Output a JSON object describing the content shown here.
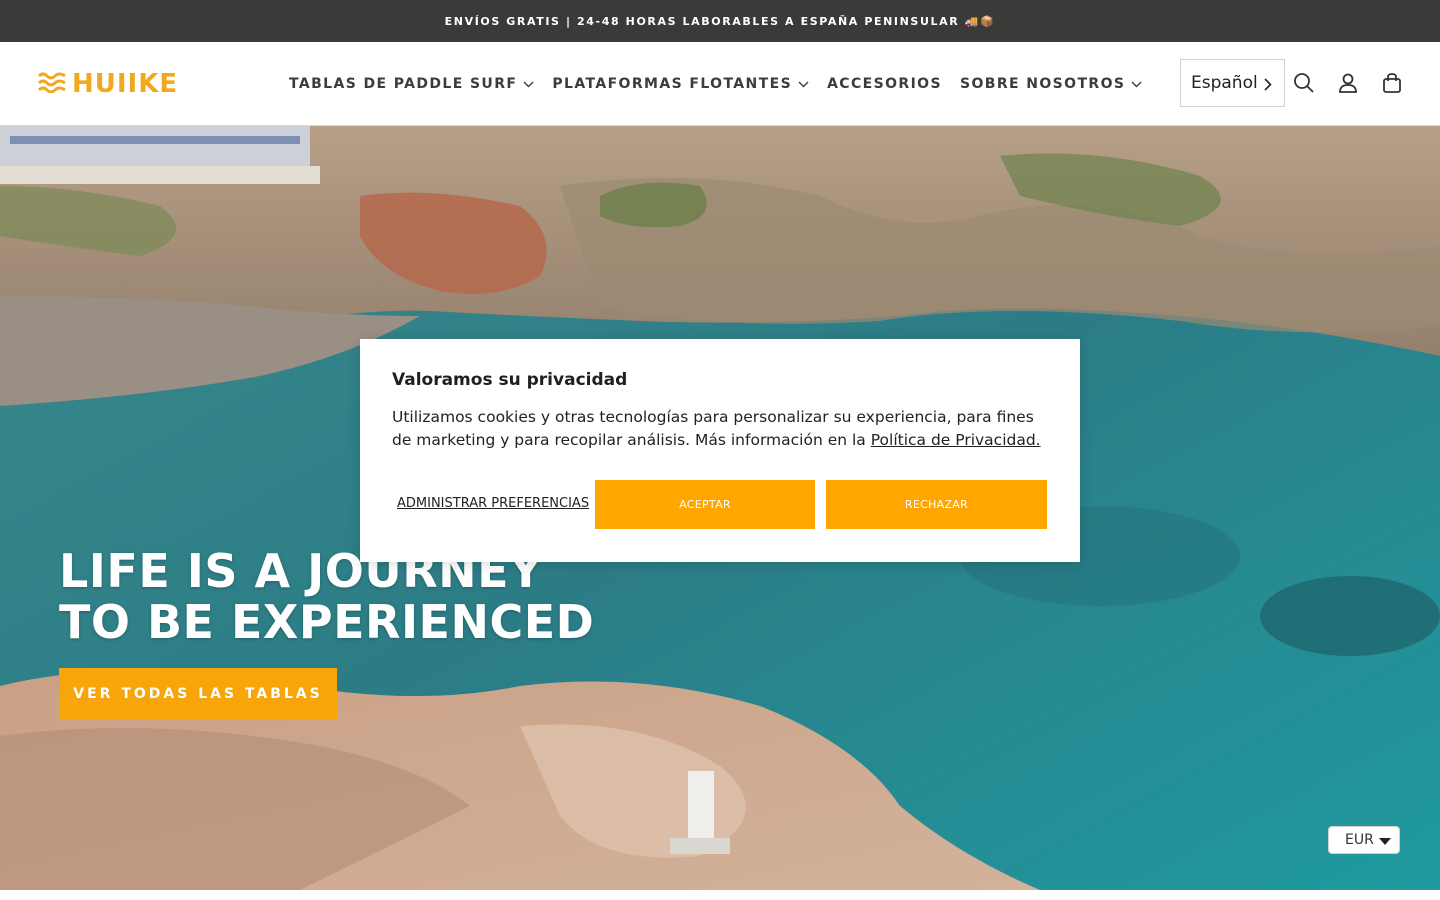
{
  "announcement": {
    "text": "ENVÍOS GRATIS | 24-48 HORAS LABORABLES A ESPAÑA PENINSULAR 🚚📦"
  },
  "header": {
    "logo_text": "HUIIKE",
    "nav": [
      {
        "label": "TABLAS DE PADDLE SURF",
        "has_dropdown": true
      },
      {
        "label": "PLATAFORMAS FLOTANTES",
        "has_dropdown": true
      },
      {
        "label": "ACCESORIOS",
        "has_dropdown": false
      },
      {
        "label": "SOBRE NOSOTROS",
        "has_dropdown": true
      }
    ],
    "language": "Español",
    "icons": [
      "search-icon",
      "account-icon",
      "cart-icon"
    ]
  },
  "hero": {
    "title_line1": "LIFE IS A JOURNEY",
    "title_line2": "TO BE EXPERIENCED",
    "cta_label": "VER TODAS LAS TABLAS"
  },
  "cookie_banner": {
    "title": "Valoramos su privacidad",
    "body": "Utilizamos cookies y otras tecnologías para personalizar su experiencia, para fines de marketing y para recopilar análisis. Más información en la ",
    "link_text": "Política de Privacidad.",
    "manage_label": "ADMINISTRAR PREFERENCIAS",
    "accept_label": "ACEPTAR",
    "reject_label": "RECHAZAR"
  },
  "currency": {
    "selected": "EUR"
  },
  "colors": {
    "accent": "#f7a50b",
    "announcement_bg": "#3a3a38",
    "nav_text": "#3c3c3c",
    "water": "#2f7d86"
  }
}
